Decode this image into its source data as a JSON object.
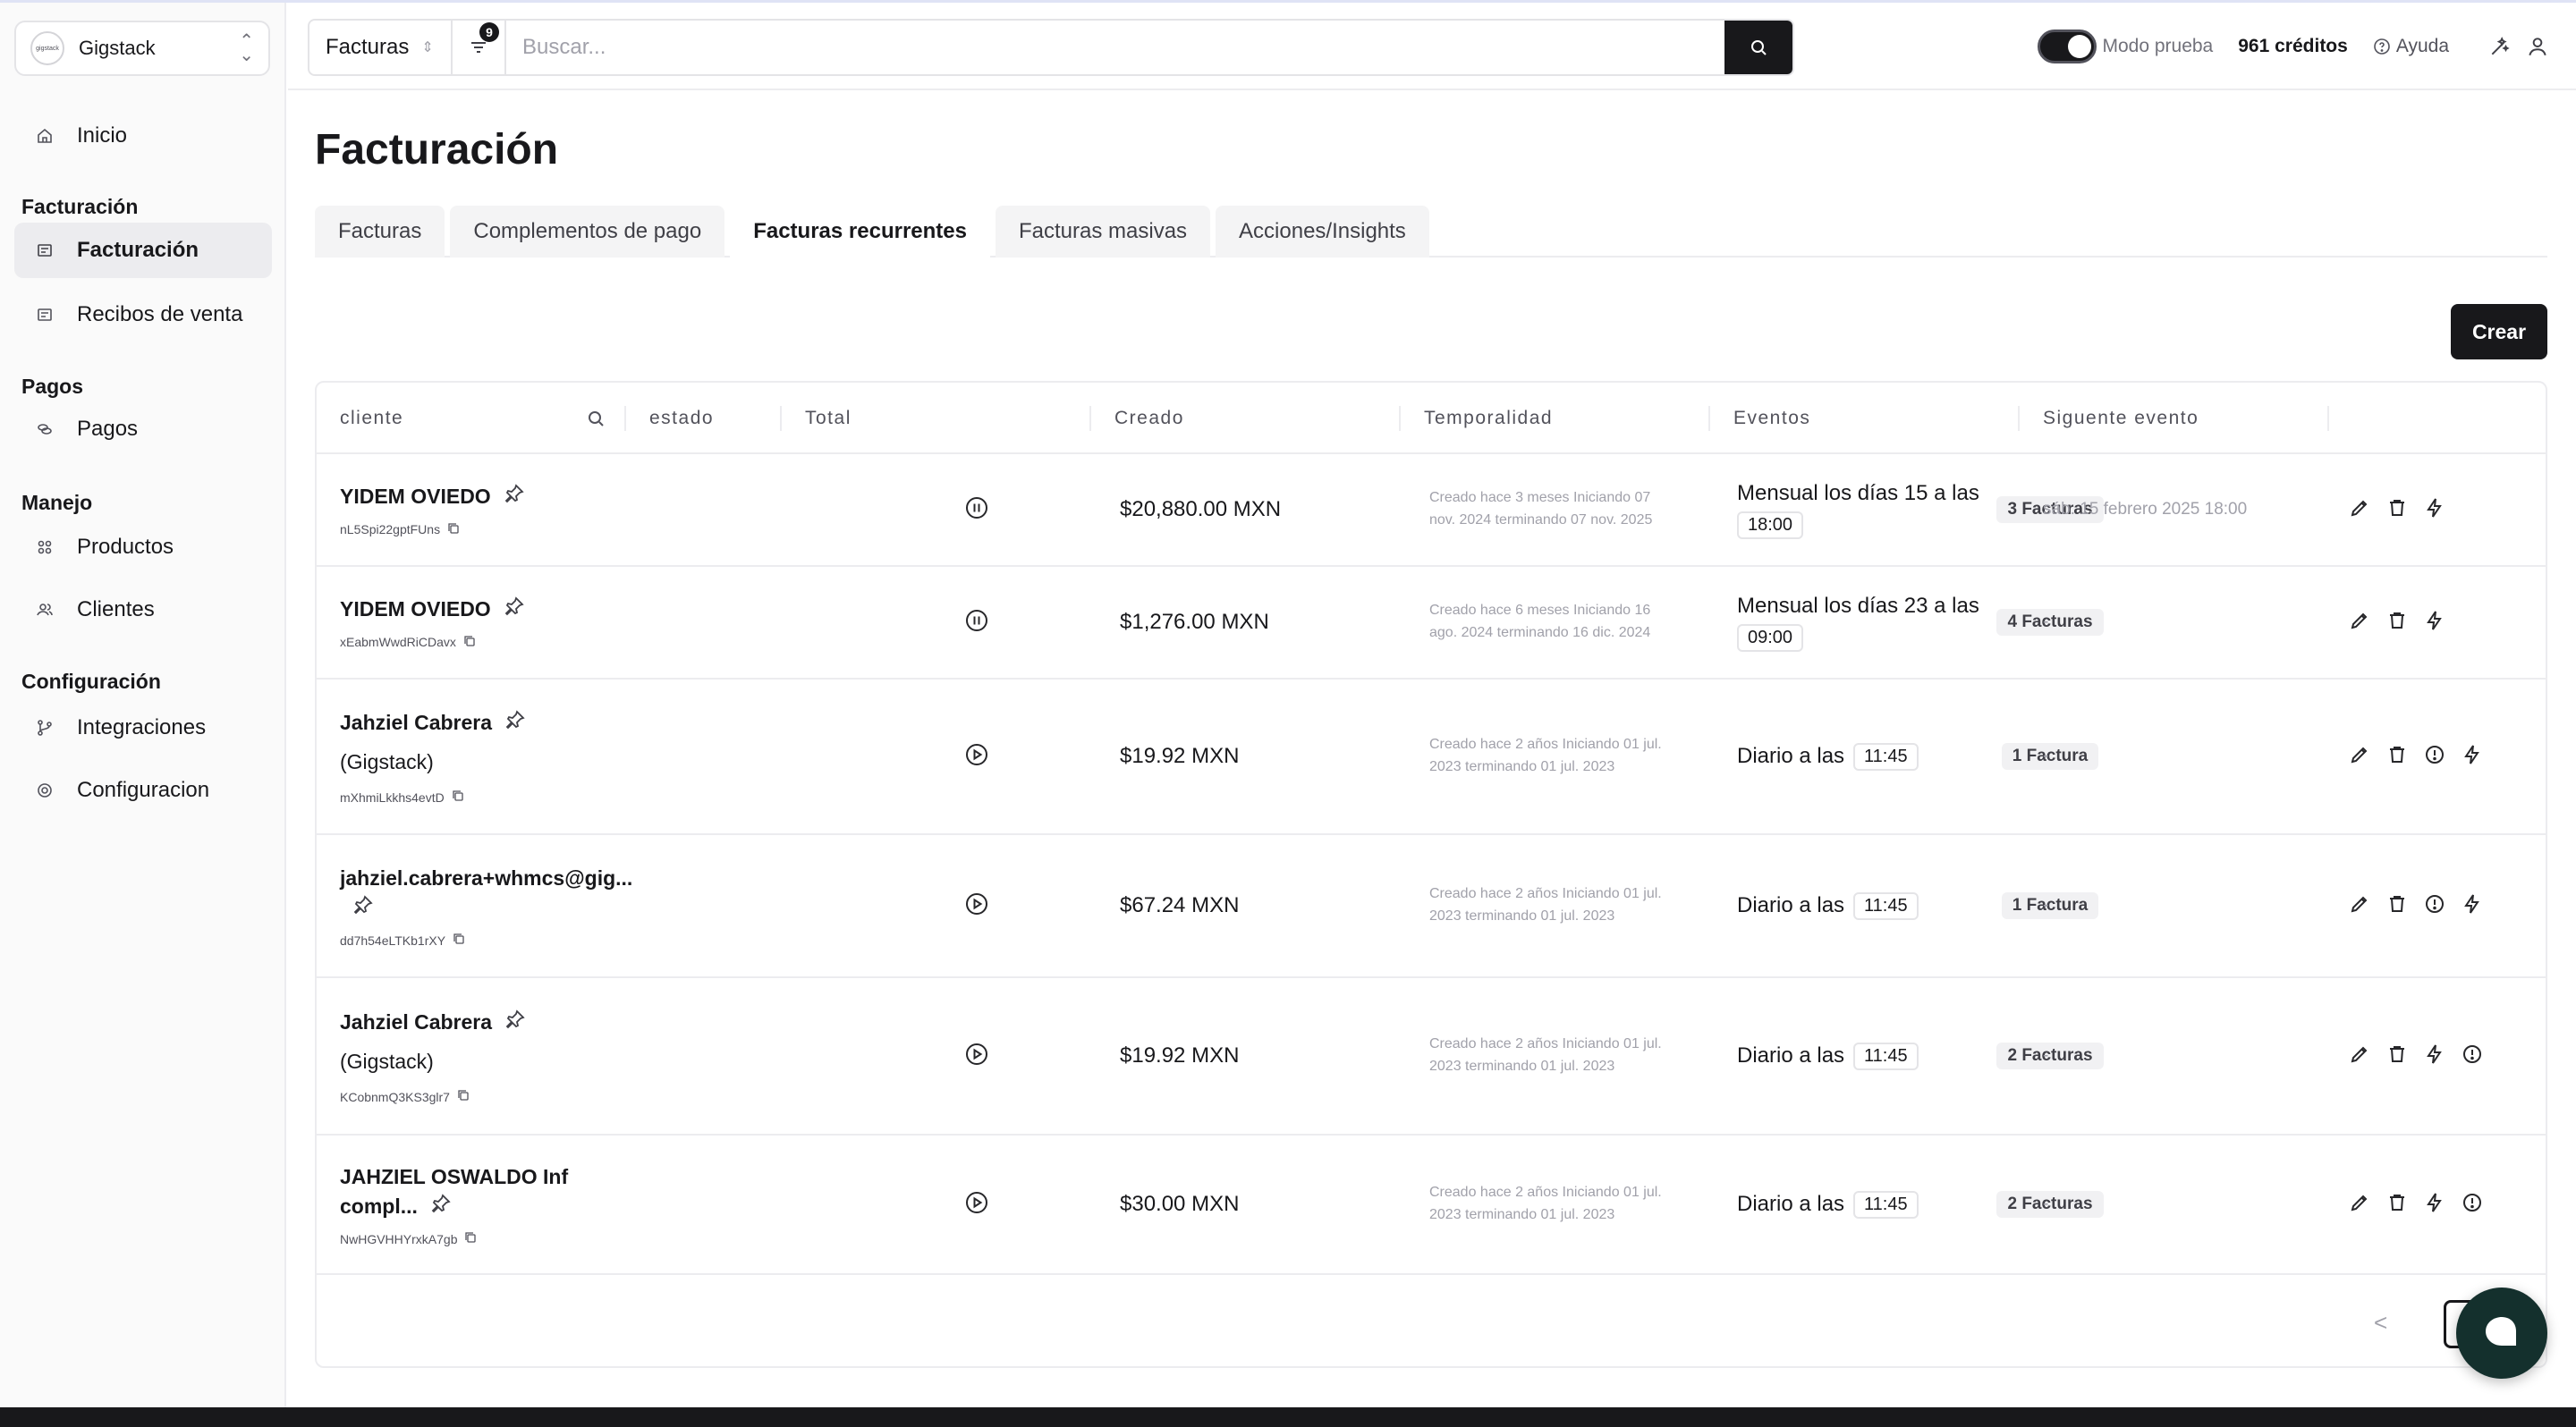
{
  "org": {
    "name": "Gigstack",
    "logo_text": "gigstack"
  },
  "sidebar": {
    "home": "Inicio",
    "sections": [
      {
        "title": "Facturación",
        "items": [
          {
            "label": "Facturación",
            "icon": "invoice-icon",
            "active": true
          },
          {
            "label": "Recibos de venta",
            "icon": "receipt-icon",
            "active": false
          }
        ]
      },
      {
        "title": "Pagos",
        "items": [
          {
            "label": "Pagos",
            "icon": "coins-icon",
            "active": false
          }
        ]
      },
      {
        "title": "Manejo",
        "items": [
          {
            "label": "Productos",
            "icon": "grid-icon",
            "active": false
          },
          {
            "label": "Clientes",
            "icon": "users-icon",
            "active": false
          }
        ]
      },
      {
        "title": "Configuración",
        "items": [
          {
            "label": "Integraciones",
            "icon": "git-branch-icon",
            "active": false
          },
          {
            "label": "Configuracion",
            "icon": "gear-icon",
            "active": false
          }
        ]
      }
    ]
  },
  "topbar": {
    "scope": "Facturas",
    "filter_count": "9",
    "search_placeholder": "Buscar...",
    "mode_label": "Modo prueba",
    "credits": "961 créditos",
    "help": "Ayuda"
  },
  "page": {
    "title": "Facturación",
    "tabs": [
      "Facturas",
      "Complementos de pago",
      "Facturas recurrentes",
      "Facturas masivas",
      "Acciones/Insights"
    ],
    "active_tab": 2,
    "create_label": "Crear"
  },
  "table": {
    "headers": [
      "cliente",
      "estado",
      "Total",
      "Creado",
      "Temporalidad",
      "Eventos",
      "Siguente evento"
    ],
    "rows": [
      {
        "name": "YIDEM OVIEDO",
        "sub": "",
        "id": "nL5Spi22gptFUns",
        "status": "pause",
        "total": "$20,880.00 MXN",
        "created": "Creado hace 3 meses Iniciando 07 nov. 2024 terminando 07 nov. 2025",
        "temp_text": "Mensual los días 15 a las",
        "time": "18:00",
        "time_inline": false,
        "events": "3 Facturas",
        "next": "sáb. 15 febrero 2025 18:00",
        "actions": [
          "edit",
          "trash",
          "bolt"
        ]
      },
      {
        "name": "YIDEM OVIEDO",
        "sub": "",
        "id": "xEabmWwdRiCDavx",
        "status": "pause",
        "total": "$1,276.00 MXN",
        "created": "Creado hace 6 meses Iniciando 16 ago. 2024 terminando 16 dic. 2024",
        "temp_text": "Mensual los días 23 a las",
        "time": "09:00",
        "time_inline": false,
        "events": "4 Facturas",
        "next": "-",
        "actions": [
          "edit",
          "trash",
          "bolt"
        ]
      },
      {
        "name": "Jahziel Cabrera",
        "sub": "(Gigstack)",
        "id": "mXhmiLkkhs4evtD",
        "status": "play",
        "total": "$19.92 MXN",
        "created": "Creado hace 2 años Iniciando 01 jul. 2023 terminando 01 jul. 2023",
        "temp_text": "Diario a las",
        "time": "11:45",
        "time_inline": true,
        "events": "1 Factura",
        "next": "-",
        "actions": [
          "edit",
          "trash",
          "alert",
          "bolt"
        ]
      },
      {
        "name": "jahziel.cabrera+whmcs@gig...",
        "sub": "",
        "id": "dd7h54eLTKb1rXY",
        "status": "play",
        "total": "$67.24 MXN",
        "created": "Creado hace 2 años Iniciando 01 jul. 2023 terminando 01 jul. 2023",
        "temp_text": "Diario a las",
        "time": "11:45",
        "time_inline": true,
        "events": "1 Factura",
        "next": "-",
        "actions": [
          "edit",
          "trash",
          "alert",
          "bolt"
        ]
      },
      {
        "name": "Jahziel Cabrera",
        "sub": "(Gigstack)",
        "id": "KCobnmQ3KS3glr7",
        "status": "play",
        "total": "$19.92 MXN",
        "created": "Creado hace 2 años Iniciando 01 jul. 2023 terminando 01 jul. 2023",
        "temp_text": "Diario a las",
        "time": "11:45",
        "time_inline": true,
        "events": "2 Facturas",
        "next": "-",
        "actions": [
          "edit",
          "trash",
          "bolt",
          "alert"
        ]
      },
      {
        "name": "JAHZIEL OSWALDO Inf compl...",
        "sub": "",
        "id": "NwHGVHHYrxkA7gb",
        "status": "play",
        "total": "$30.00 MXN",
        "created": "Creado hace 2 años Iniciando 01 jul. 2023 terminando 01 jul. 2023",
        "temp_text": "Diario a las",
        "time": "11:45",
        "time_inline": true,
        "events": "2 Facturas",
        "next": "-",
        "actions": [
          "edit",
          "trash",
          "bolt",
          "alert"
        ]
      }
    ]
  },
  "pager": {
    "prev": "<"
  },
  "colors": {
    "primary": "#18181b",
    "chat": "#14302d",
    "muted": "#a1a1aa"
  }
}
